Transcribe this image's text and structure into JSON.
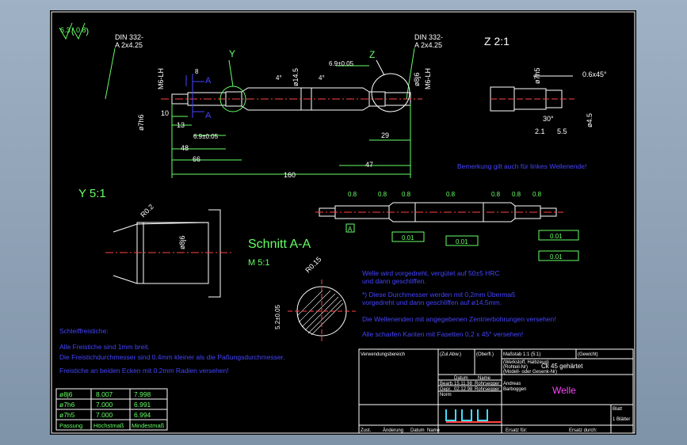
{
  "drawing": {
    "roughness": {
      "outer": "6.3",
      "inner": "0.8"
    },
    "din_left": [
      "DIN 332-",
      "A 2x4.25"
    ],
    "din_right": [
      "DIN 332-",
      "A 2x4.25"
    ],
    "thread_left": "M6-LH",
    "thread_right": "M6-LH",
    "section_letter_left": "A",
    "section_letter_left2": "A",
    "label_y": "Y",
    "label_z": "Z",
    "dims": {
      "d10": "10",
      "d13": "13",
      "d48": "48",
      "d66": "66",
      "d160": "160",
      "d47": "47",
      "d29": "29",
      "d69a": "6.9±0.05",
      "d69b": "6.9±0.05",
      "d8": "8",
      "d4": "4",
      "d4b": "4°",
      "d4c": "4°",
      "dia7h6": "ø7h6",
      "dia145": "ø14.5",
      "dia8j6": "ø8j6"
    },
    "z_view": {
      "title": "Z 2:1",
      "chamfer": "0.6x45°",
      "dia": "ø7h5",
      "dia2": "ø4.5",
      "d30": "30°",
      "d21": "2.1",
      "d55": "5.5"
    },
    "note_right": "Bemerkung gilt auch für linkes Wellenende!",
    "y_view": {
      "title": "Y 5:1",
      "r02": "R0.2",
      "dia": "ø8j6"
    },
    "section": {
      "title": "Schnitt A-A",
      "scale": "M 5:1",
      "radius": "R0.15",
      "dim": "5.2±0.05"
    },
    "tol_frames": [
      "0.01",
      "0.01",
      "0.01",
      "0.01",
      "0.01"
    ],
    "tol_datum": "A",
    "roughness_marks": [
      "0.8",
      "0.8",
      "0.8",
      "0.8",
      "0.8",
      "0.8",
      "0.8"
    ],
    "notes": [
      "Welle wird vorgedreht, vergütet auf 50±5 HRC",
      "und dann geschliffen.",
      "*) Diese Durchmesser werden mit 0,2mm Übermaß",
      "vorgedreht und dann geschliffen auf ø14,5mm.",
      "Die Wellenenden mit angegebenen Zentrierbohrungen versehen!",
      "Alle scharfen Kanten mit Fasetten 0,2 x 45° versehen!"
    ],
    "relief_notes": [
      "Schleiffreistiche:",
      "Alle Freistiche sind 1mm breit.",
      "Die Freistichdurchmesser sind 0.4mm kleiner als die Paßungsdurchmesser.",
      "Freistiche an beiden Ecken mit 0.2mm Radien versehen!"
    ],
    "fit_table": {
      "rows": [
        [
          "ø8j6",
          "8.007",
          "7.998"
        ],
        [
          "ø7h6",
          "7.000",
          "6.991"
        ],
        [
          "ø7h5",
          "7.000",
          "6.994"
        ]
      ],
      "footer": [
        "Passung",
        "Höchstmaß",
        "Mindestmaß"
      ]
    },
    "title_block": {
      "usage": "Verwendungsbereich",
      "zul_abw": "(Zul.Abw.)",
      "oberfl": "(Oberfl.)",
      "scale": "Maßstab 1:1 (5:1)",
      "weight": "(Gewicht)",
      "material_label": "(Werkstoff, Halbzeug)",
      "material_label2": "(Rohteil-Nr)",
      "material_label3": "(Modell- oder Gesenk-Nr)",
      "material": "Ck 45 gehärtet",
      "datum": "Datum",
      "name": "Name",
      "bearb": "Bearb.",
      "gepr": "Gepr.",
      "norm": "Norm",
      "bearb_date": "15.11.98",
      "gepr_date": "02.12.98",
      "bearb_name": "Rohrsegger",
      "gepr_name": "Rohrsegger",
      "name_head1": "Andreas",
      "name_head2": "Barboggen",
      "title": "Welle",
      "blatt": "Blatt",
      "blatter": "1 Blätter",
      "zust": "Zust.",
      "aenderung": "Änderung",
      "datum2": "Datum",
      "name2": "Name",
      "ersatz_fuer": "Ersatz für:",
      "ersatz_durch": "Ersatz durch:"
    }
  }
}
